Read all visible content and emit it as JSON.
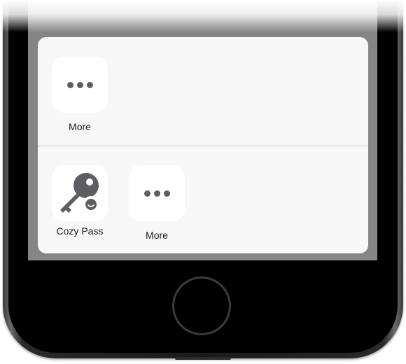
{
  "share_sheet": {
    "top_row": {
      "more": {
        "label": "More",
        "icon": "ellipsis-icon"
      }
    },
    "bottom_row": {
      "apps": [
        {
          "label": "Cozy Pass",
          "icon": "key-icon"
        },
        {
          "label": "More",
          "icon": "ellipsis-icon"
        }
      ]
    }
  },
  "colors": {
    "sheet_background": "#f7f7f7",
    "icon_tile": "#ffffff",
    "glyph": "#5e5e62",
    "phone_body": "#1a1a1a",
    "screen_dim": "#858585"
  }
}
